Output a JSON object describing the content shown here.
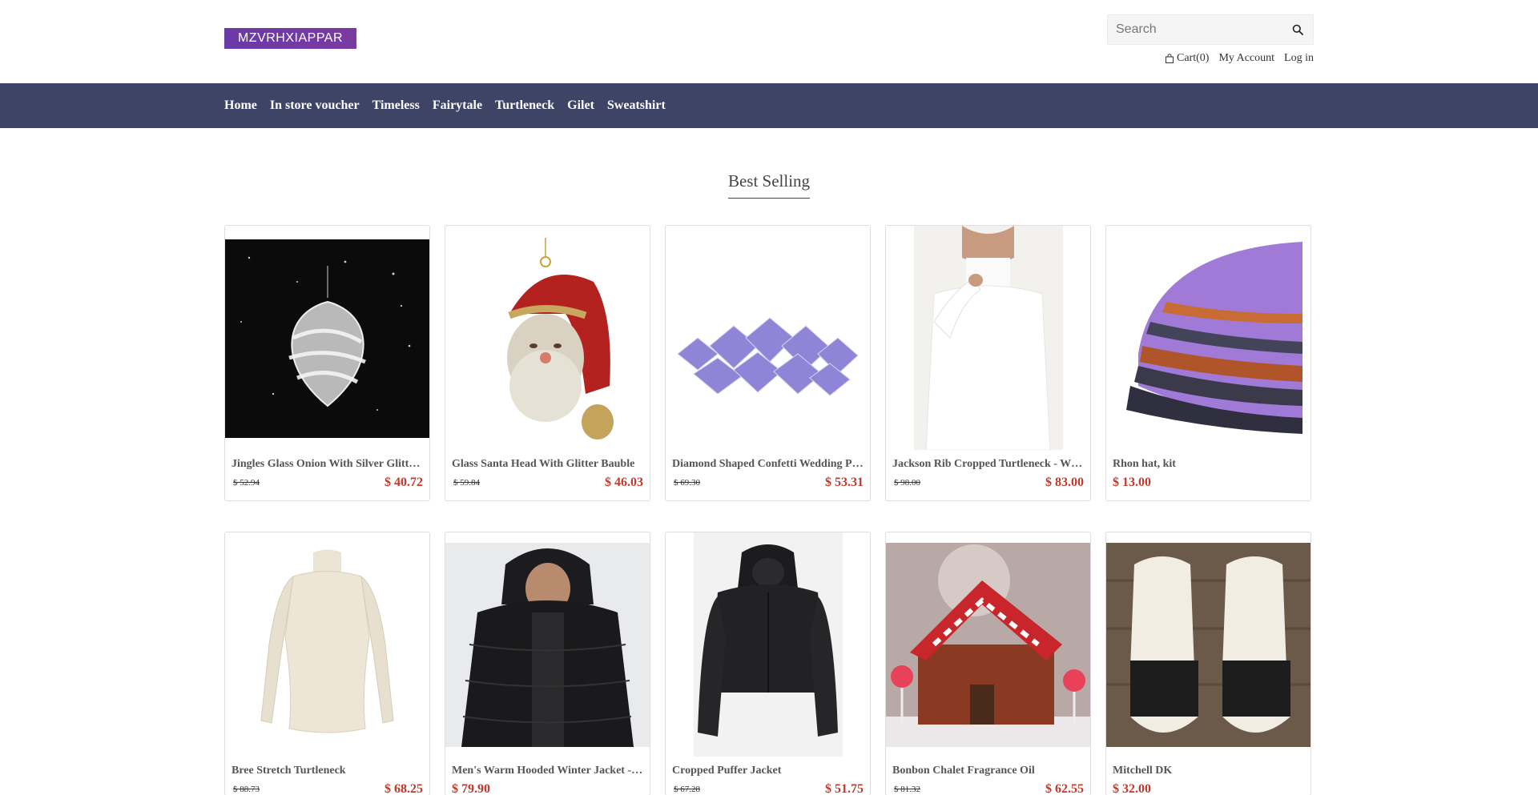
{
  "header": {
    "logo_text": "MZVRHXIAPPAR",
    "search_placeholder": "Search",
    "cart_label": "Cart(0)",
    "my_account_label": "My Account",
    "login_label": "Log in"
  },
  "nav": {
    "items": [
      "Home",
      "In store voucher",
      "Timeless",
      "Fairytale",
      "Turtleneck",
      "Gilet",
      "Sweatshirt"
    ]
  },
  "section": {
    "title": "Best Selling"
  },
  "products": [
    {
      "name": "Jingles Glass Onion With Silver Glitter Bauble",
      "old_price": "$ 52.94",
      "price": "$ 40.72",
      "image": "glass-onion-bauble"
    },
    {
      "name": "Glass Santa Head With Glitter Bauble",
      "old_price": "$ 59.84",
      "price": "$ 46.03",
      "image": "santa-head-bauble"
    },
    {
      "name": "Diamond Shaped Confetti Wedding Party",
      "old_price": "$ 69.30",
      "price": "$ 53.31",
      "image": "diamond-confetti"
    },
    {
      "name": "Jackson Rib Cropped Turtleneck - White",
      "old_price": "$ 98.00",
      "price": "$ 83.00",
      "image": "white-turtleneck"
    },
    {
      "name": "Rhon hat, kit",
      "old_price": "",
      "price": "$ 13.00",
      "image": "knit-hat"
    },
    {
      "name": "Bree Stretch Turtleneck",
      "old_price": "$ 88.73",
      "price": "$ 68.25",
      "image": "cream-turtleneck"
    },
    {
      "name": "Men's Warm Hooded Winter Jacket - Black",
      "old_price": "",
      "price": "$ 79.90",
      "image": "hooded-jacket"
    },
    {
      "name": "Cropped Puffer Jacket",
      "old_price": "$ 67.28",
      "price": "$ 51.75",
      "image": "puffer-jacket"
    },
    {
      "name": "Bonbon Chalet Fragrance Oil",
      "old_price": "$ 81.32",
      "price": "$ 62.55",
      "image": "candy-chalet"
    },
    {
      "name": "Mitchell DK",
      "old_price": "",
      "price": "$ 32.00",
      "image": "yarn-skeins"
    }
  ]
}
